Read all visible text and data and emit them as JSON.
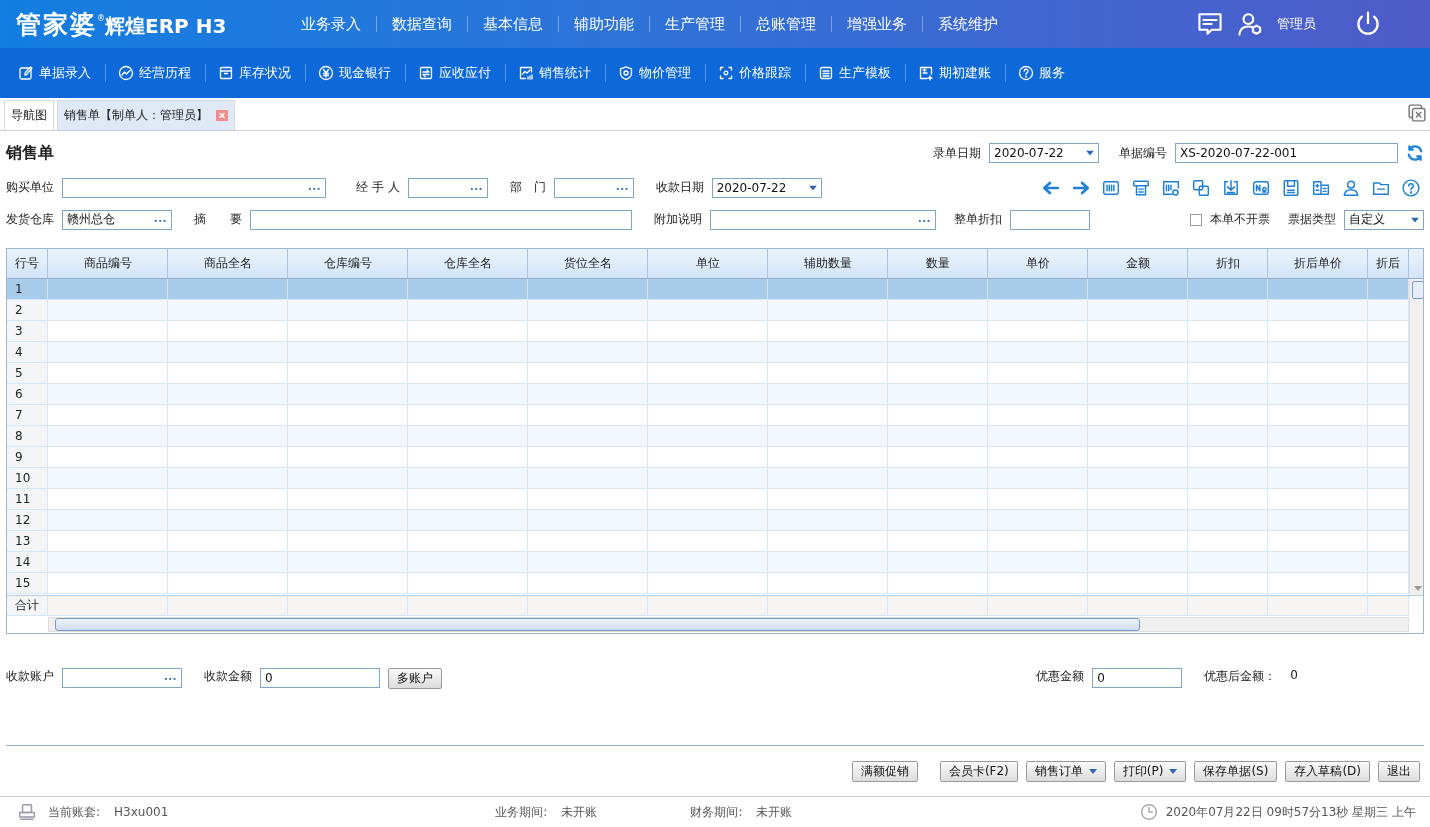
{
  "app": {
    "logo": "管家婆",
    "product": "辉煌ERP H3",
    "mark": "®",
    "menu": [
      "业务录入",
      "数据查询",
      "基本信息",
      "辅助功能",
      "生产管理",
      "总账管理",
      "增强业务",
      "系统维护"
    ],
    "user": "管理员"
  },
  "toolbar": [
    "单据录入",
    "经营历程",
    "库存状况",
    "现金银行",
    "应收应付",
    "销售统计",
    "物价管理",
    "价格跟踪",
    "生产模板",
    "期初建账",
    "服务"
  ],
  "tabs": [
    {
      "label": "导航图",
      "selected": false,
      "closable": false
    },
    {
      "label": "销售单【制单人：管理员】",
      "selected": true,
      "closable": true
    }
  ],
  "form": {
    "title": "销售单",
    "entry_date": {
      "label": "录单日期",
      "value": "2020-07-22"
    },
    "doc_no": {
      "label": "单据编号",
      "value": "XS-2020-07-22-001"
    },
    "buyer": {
      "label": "购买单位"
    },
    "handler": {
      "label": "经 手 人"
    },
    "dept": {
      "label": "部　门"
    },
    "pay_date": {
      "label": "收款日期",
      "value": "2020-07-22"
    },
    "warehouse": {
      "label": "发货仓库",
      "value": "赣州总仓"
    },
    "summary": {
      "label": "摘　　要"
    },
    "note": {
      "label": "附加说明"
    },
    "discount": {
      "label": "整单折扣"
    },
    "no_invoice": {
      "label": "本单不开票",
      "checked": false
    },
    "doc_type": {
      "label": "票据类型",
      "value": "自定义"
    }
  },
  "grid": {
    "columns": [
      "行号",
      "商品编号",
      "商品全名",
      "仓库编号",
      "仓库全名",
      "货位全名",
      "单位",
      "辅助数量",
      "数量",
      "单价",
      "金额",
      "折扣",
      "折后单价",
      "折后"
    ],
    "rows": [
      {
        "number": "1",
        "selected": true
      },
      {
        "number": "2",
        "selected": false
      },
      {
        "number": "3",
        "selected": false
      },
      {
        "number": "4",
        "selected": false
      },
      {
        "number": "5",
        "selected": false
      },
      {
        "number": "6",
        "selected": false
      },
      {
        "number": "7",
        "selected": false
      },
      {
        "number": "8",
        "selected": false
      },
      {
        "number": "9",
        "selected": false
      },
      {
        "number": "10",
        "selected": false
      },
      {
        "number": "11",
        "selected": false
      },
      {
        "number": "12",
        "selected": false
      },
      {
        "number": "13",
        "selected": false
      },
      {
        "number": "14",
        "selected": false
      },
      {
        "number": "15",
        "selected": false
      }
    ],
    "total_label": "合计"
  },
  "payment": {
    "account": {
      "label": "收款账户"
    },
    "amount": {
      "label": "收款金额",
      "value": "0"
    },
    "multi_button": "多账户",
    "discount": {
      "label": "优惠金额",
      "value": "0"
    },
    "after_label": "优惠后金额：",
    "after_value": "0"
  },
  "buttons": [
    {
      "label": "满额促销",
      "dropdown": false
    },
    {
      "label": "会员卡(F2)",
      "dropdown": false
    },
    {
      "label": "销售订单",
      "dropdown": true
    },
    {
      "label": "打印(P)",
      "dropdown": true
    },
    {
      "label": "保存单据(S)",
      "dropdown": false
    },
    {
      "label": "存入草稿(D)",
      "dropdown": false
    },
    {
      "label": "退出",
      "dropdown": false
    }
  ],
  "status": {
    "account_label": "当前账套:",
    "account": "H3xu001",
    "biz_label": "业务期间:",
    "biz": "未开账",
    "fin_label": "财务期间:",
    "fin": "未开账",
    "datetime": "2020年07月22日 09时57分13秒 星期三 上午"
  }
}
